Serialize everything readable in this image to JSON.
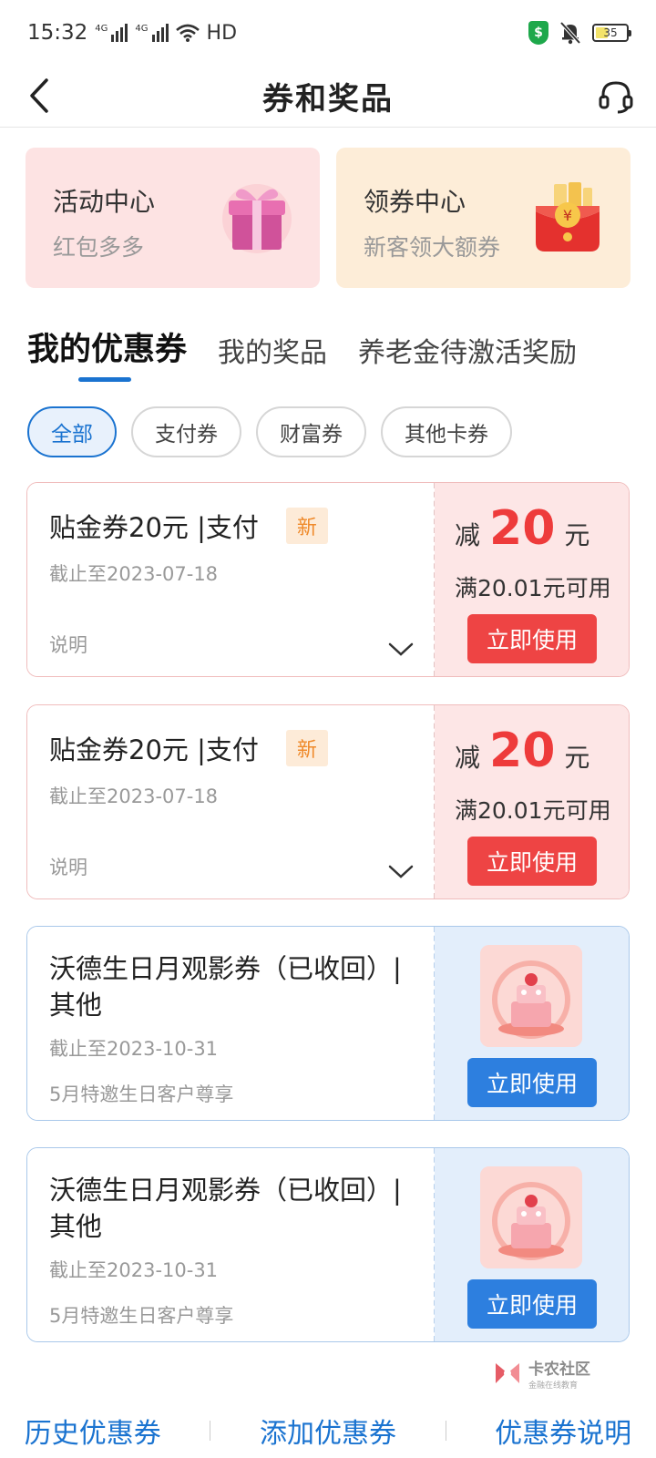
{
  "status": {
    "time": "15:32",
    "net1": "4G",
    "net2": "4G",
    "hd": "HD",
    "battery": "35",
    "shield_glyph": "$"
  },
  "header": {
    "title": "券和奖品",
    "back_icon": "chevron-left-icon",
    "service_icon": "headset-icon"
  },
  "promos": [
    {
      "title": "活动中心",
      "subtitle": "红包多多",
      "icon": "gift-box-icon"
    },
    {
      "title": "领券中心",
      "subtitle": "新客领大额券",
      "icon": "red-envelope-icon"
    }
  ],
  "tabs": [
    {
      "label": "我的优惠券",
      "active": true
    },
    {
      "label": "我的奖品",
      "active": false
    },
    {
      "label": "养老金待激活奖励",
      "active": false
    }
  ],
  "chips": [
    {
      "label": "全部",
      "active": true
    },
    {
      "label": "支付券",
      "active": false
    },
    {
      "label": "财富券",
      "active": false
    },
    {
      "label": "其他卡券",
      "active": false
    }
  ],
  "coupons": [
    {
      "title": "贴金券20元 |支付",
      "badge": "新",
      "date": "截止至2023-07-18",
      "note": "说明",
      "amount_prefix": "减",
      "amount": "20",
      "amount_unit": "元",
      "condition": "满20.01元可用",
      "button": "立即使用"
    },
    {
      "title": "贴金券20元 |支付",
      "badge": "新",
      "date": "截止至2023-07-18",
      "note": "说明",
      "amount_prefix": "减",
      "amount": "20",
      "amount_unit": "元",
      "condition": "满20.01元可用",
      "button": "立即使用"
    },
    {
      "title": "沃德生日月观影券（已收回）|其他",
      "date": "截止至2023-10-31",
      "desc": "5月特邀生日客户尊享",
      "button": "立即使用",
      "icon": "birthday-cake-icon"
    },
    {
      "title": "沃德生日月观影券（已收回）|其他",
      "date": "截止至2023-10-31",
      "desc": "5月特邀生日客户尊享",
      "button": "立即使用",
      "icon": "birthday-cake-icon"
    }
  ],
  "watermark": {
    "text": "卡农社区",
    "sub": "金融在线教育"
  },
  "bottom": {
    "history": "历史优惠券",
    "add": "添加优惠券",
    "explain": "优惠券说明"
  },
  "colors": {
    "accent_blue": "#1a73d0",
    "coupon_red": "#ee3b3b",
    "badge_orange": "#ef8a2b"
  }
}
